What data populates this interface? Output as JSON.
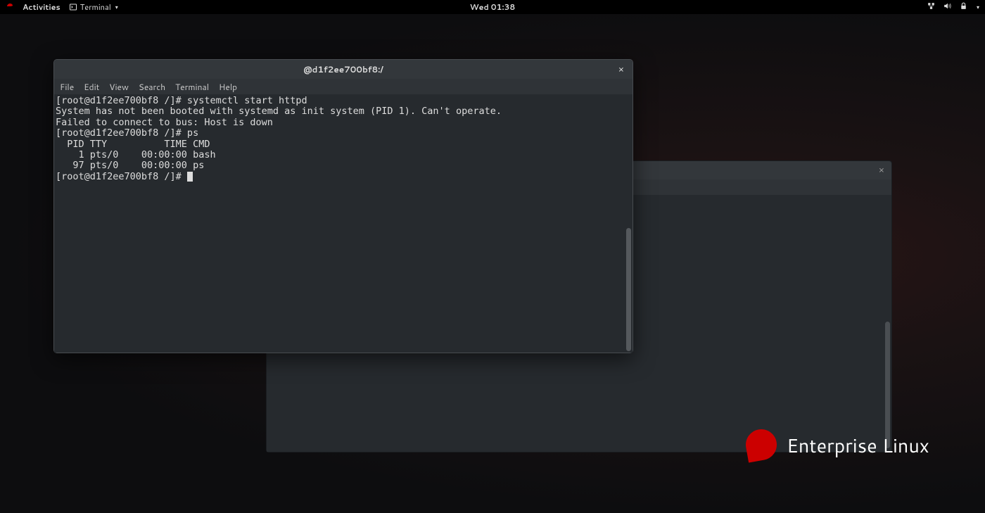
{
  "topbar": {
    "activities": "Activities",
    "appname": "Terminal",
    "clock": "Wed 01:38"
  },
  "bg_window": {
    "close": "×"
  },
  "fg_window": {
    "title": "@d1f2ee700bf8:/",
    "close": "×",
    "menu": {
      "file": "File",
      "edit": "Edit",
      "view": "View",
      "search": "Search",
      "terminal": "Terminal",
      "help": "Help"
    },
    "lines": [
      "[root@d1f2ee700bf8 /]# systemctl start httpd",
      "System has not been booted with systemd as init system (PID 1). Can't operate.",
      "Failed to connect to bus: Host is down",
      "[root@d1f2ee700bf8 /]# ps",
      "  PID TTY          TIME CMD",
      "    1 pts/0    00:00:00 bash",
      "   97 pts/0    00:00:00 ps",
      "[root@d1f2ee700bf8 /]# "
    ]
  },
  "brand": "Enterprise Linux"
}
